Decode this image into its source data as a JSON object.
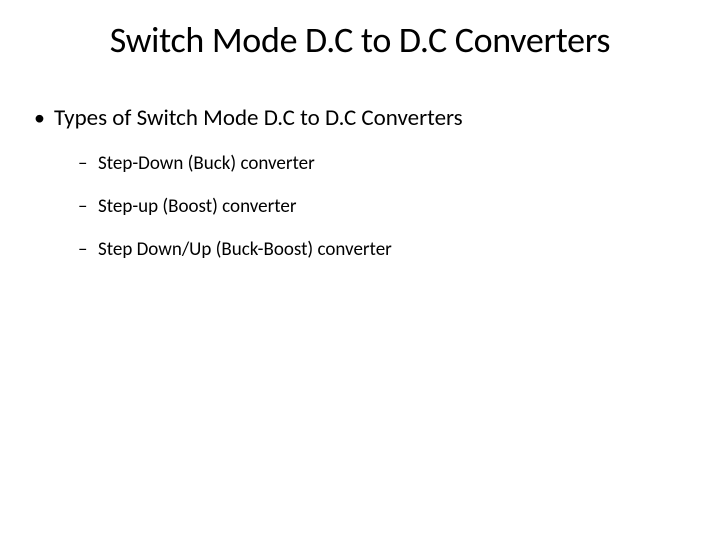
{
  "slide": {
    "title": "Switch Mode D.C to D.C Converters",
    "bullets": {
      "level1_0": "Types of Switch Mode D.C to D.C Converters",
      "level2_0": "Step-Down (Buck) converter",
      "level2_1": "Step-up (Boost)  converter",
      "level2_2": "Step Down/Up (Buck-Boost) converter"
    }
  }
}
